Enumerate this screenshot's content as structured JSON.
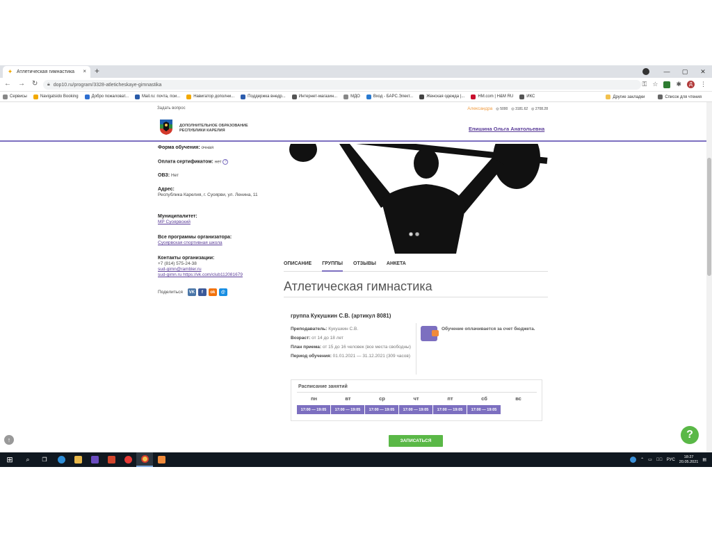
{
  "browser": {
    "tab_title": "Атлетическая гимнастика",
    "tab_close": "×",
    "new_tab": "+",
    "url": "dop10.ru/program/3328-atleticheskaye-gimnastika",
    "account_initial": "Д",
    "window_controls": [
      "—",
      "▢",
      "✕"
    ]
  },
  "bookmarks": [
    {
      "label": "Сервисы",
      "color": "#888888"
    },
    {
      "label": "Navigatsido Booking",
      "color": "#f2a900"
    },
    {
      "label": "Добро пожаловат...",
      "color": "#2f6fd0"
    },
    {
      "label": "Mail.ru: почта, пои...",
      "color": "#2a5ba8"
    },
    {
      "label": "Навигатор дополни...",
      "color": "#f2a900"
    },
    {
      "label": "Поддержка внедр...",
      "color": "#2c5cad"
    },
    {
      "label": "Интернет-магазин...",
      "color": "#555555"
    },
    {
      "label": "МДО",
      "color": "#888888"
    },
    {
      "label": "Вход - БАРС.Элект...",
      "color": "#2a7ad0"
    },
    {
      "label": "Женская одежда |...",
      "color": "#444444"
    },
    {
      "label": "HM.com | H&M RU",
      "color": "#c8102e"
    },
    {
      "label": "ИКС",
      "color": "#555555"
    }
  ],
  "bookmarks_right": [
    {
      "label": "Другие закладки",
      "color": "#f2c14e"
    },
    {
      "label": "Список для чтения",
      "color": "#666666"
    }
  ],
  "page": {
    "ask_question": "Задать вопрос",
    "top_user": "Александра",
    "top_stats": [
      "5000",
      "3181.62",
      "2708.28"
    ],
    "logo_text_line1": "ДОПОЛНИТЕЛЬНОЕ ОБРАЗОВАНИЕ",
    "logo_text_line2": "РЕСПУБЛИКИ КАРЕЛИЯ",
    "user_link": "Епишина Ольга Анатольевна"
  },
  "left": {
    "form_label": "Форма обучения:",
    "form_value": "очная",
    "cert_label": "Оплата сертификатом:",
    "cert_value": "нет",
    "help": "?",
    "ovz_label": "ОВЗ:",
    "ovz_value": "Нет",
    "address_label": "Адрес:",
    "address_value": "Республика Карелия, г. Суоярви, ул. Ленина, 11",
    "municipality_label": "Муниципалитет:",
    "municipality_value": "МР Суоярвский",
    "programs_label": "Все программы организатора:",
    "programs_value": "Суоярвская спортивная школа",
    "contacts_label": "Контакты организации:",
    "contact_phone": "+7 (814) 575-24-38",
    "contact_email": "sud-gimn@rambler.ru",
    "contact_link": "sud-gimn.ru https://vk.com/club112081679",
    "share_label": "Поделиться",
    "share_icons": [
      {
        "name": "vk-icon",
        "text": "VK",
        "color": "#4a76a8"
      },
      {
        "name": "facebook-icon",
        "text": "f",
        "color": "#3b5998"
      },
      {
        "name": "odnoklassniki-icon",
        "text": "ok",
        "color": "#f2720c"
      },
      {
        "name": "moimir-icon",
        "text": "@",
        "color": "#168de2"
      }
    ]
  },
  "tabs": [
    "ОПИСАНИЕ",
    "ГРУППЫ",
    "ОТЗЫВЫ",
    "АНКЕТА"
  ],
  "active_tab": "ГРУППЫ",
  "program_title": "Атлетическая гимнастика",
  "group": {
    "title": "группа Кукушкин С.В. (артикул 8081)",
    "teacher_label": "Преподаватель:",
    "teacher_value": "Кукушкин С.В.",
    "age_label": "Возраст:",
    "age_value": "от 14 до 18 лет",
    "plan_label": "План приема:",
    "plan_value": "от 15 до 16 человек (все места свободны)",
    "period_label": "Период обучения:",
    "period_value": "01.01.2021 — 31.12.2021 (309 часов)",
    "budget_text": "Обучение оплачивается за счет бюджета."
  },
  "schedule": {
    "title": "Расписание занятий",
    "days": [
      "пн",
      "вт",
      "ср",
      "чт",
      "пт",
      "сб",
      "вс"
    ],
    "times": [
      "17:00 — 19:05",
      "17:00 — 19:05",
      "17:00 — 19:05",
      "17:00 — 19:05",
      "17:00 — 19:05",
      "17:00 — 19:05",
      ""
    ]
  },
  "enroll_button": "ЗАПИСАТЬСЯ",
  "help_button": "?",
  "up_button": "↑",
  "taskbar": {
    "clock_time": "18:27",
    "clock_date": "20.05.2021",
    "lang": "РУС"
  },
  "colors": {
    "accent": "#7c6fc0",
    "green": "#5ab847",
    "orange": "#f09a3e"
  }
}
